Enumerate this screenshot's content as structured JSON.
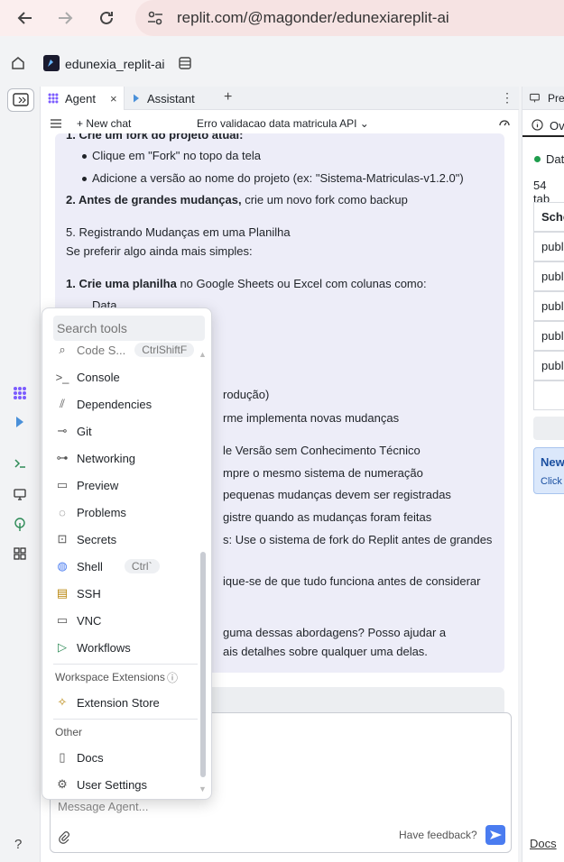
{
  "browser": {
    "url": "replit.com/@magonder/edunexiareplit-ai"
  },
  "app": {
    "repl_name": "edunexia_replit-ai"
  },
  "tabs": [
    {
      "label": "Agent"
    },
    {
      "label": "Assistant"
    }
  ],
  "chat": {
    "new_chat": "+ New chat",
    "title": "Erro validacao data matricula API ⌄"
  },
  "message": {
    "item1_title": "1. Crie um fork do projeto atual:",
    "item1_b1": "Clique em \"Fork\" no topo da tela",
    "item1_b2": "Adicione a versão ao nome do projeto (ex: \"Sistema-Matriculas-v1.2.0\")",
    "item2_bold": "2. Antes de grandes mudanças,",
    "item2_rest": " crie um novo fork como backup",
    "section5_title": "5. Registrando Mudanças em uma Planilha",
    "section5_intro": "Se preferir algo ainda mais simples:",
    "sheet_bold": "1. Crie uma planilha",
    "sheet_rest": " no Google Sheets ou Excel com colunas como:",
    "cut_1": "Data",
    "cut_prod": "rodução)",
    "cut_implementa": "rme implementa novas mudanças",
    "cut_versao": "le Versão sem Conhecimento Técnico",
    "cut_numeracao": "mpre o mesmo sistema de numeração",
    "cut_pequenas": "pequenas mudanças devem ser registradas",
    "cut_registre": "gistre quando as mudanças foram feitas",
    "cut_fork": "s: Use o sistema de fork do Replit antes de grandes",
    "cut_verifique": "ique-se de que tudo funciona antes de considerar",
    "cut_abordagens": "guma dessas abordagens? Posso ajudar a",
    "cut_detalhes": "ais detalhes sobre qualquer uma delas."
  },
  "composer": {
    "placeholder": "Message Agent...",
    "feedback": "Have feedback?"
  },
  "right_panel": {
    "tab_preview": "Prev",
    "tab_overview": "Ov",
    "db_status": "Dat",
    "tables_count": "54 tab",
    "table_header": "Sche",
    "rows": [
      "publ",
      "publ",
      "publ",
      "publ",
      "publ"
    ],
    "new_label": "New",
    "click_label": "Click",
    "docs": "Docs"
  },
  "tools_menu": {
    "search_placeholder": "Search tools",
    "partial_item": "Code S...",
    "partial_shortcut": "CtrlShiftF",
    "items": [
      {
        "label": "Console",
        "icon": "terminal-icon"
      },
      {
        "label": "Dependencies",
        "icon": "dependencies-icon"
      },
      {
        "label": "Git",
        "icon": "git-icon"
      },
      {
        "label": "Networking",
        "icon": "networking-icon"
      },
      {
        "label": "Preview",
        "icon": "preview-icon"
      },
      {
        "label": "Problems",
        "icon": "problems-icon"
      },
      {
        "label": "Secrets",
        "icon": "lock-icon"
      },
      {
        "label": "Shell",
        "icon": "shell-icon",
        "shortcut": "Ctrl`"
      },
      {
        "label": "SSH",
        "icon": "ssh-icon"
      },
      {
        "label": "VNC",
        "icon": "monitor-icon"
      },
      {
        "label": "Workflows",
        "icon": "play-icon"
      }
    ],
    "section_extensions": "Workspace Extensions",
    "extension_store": "Extension Store",
    "section_other": "Other",
    "docs": "Docs",
    "user_settings": "User Settings"
  },
  "help": "?"
}
